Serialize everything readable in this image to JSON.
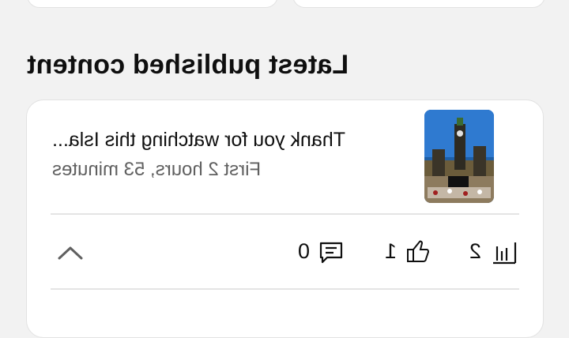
{
  "section": {
    "title": "Latest published content"
  },
  "latest_video": {
    "title": "Thank you for watching this Isla...",
    "meta": "First 2 hours, 53 minutes",
    "thumbnail_icon": "video-thumbnail",
    "stats": {
      "views": "2",
      "likes": "1",
      "comments": "0"
    }
  },
  "icons": {
    "views": "bar-chart-icon",
    "likes": "thumbs-up-icon",
    "comments": "comment-icon",
    "expand": "chevron-up-icon"
  },
  "colors": {
    "background": "#f2f2f2",
    "card": "#ffffff",
    "primary_text": "#0f0f0f",
    "secondary_text": "#606060",
    "divider": "#e4e4e4"
  }
}
